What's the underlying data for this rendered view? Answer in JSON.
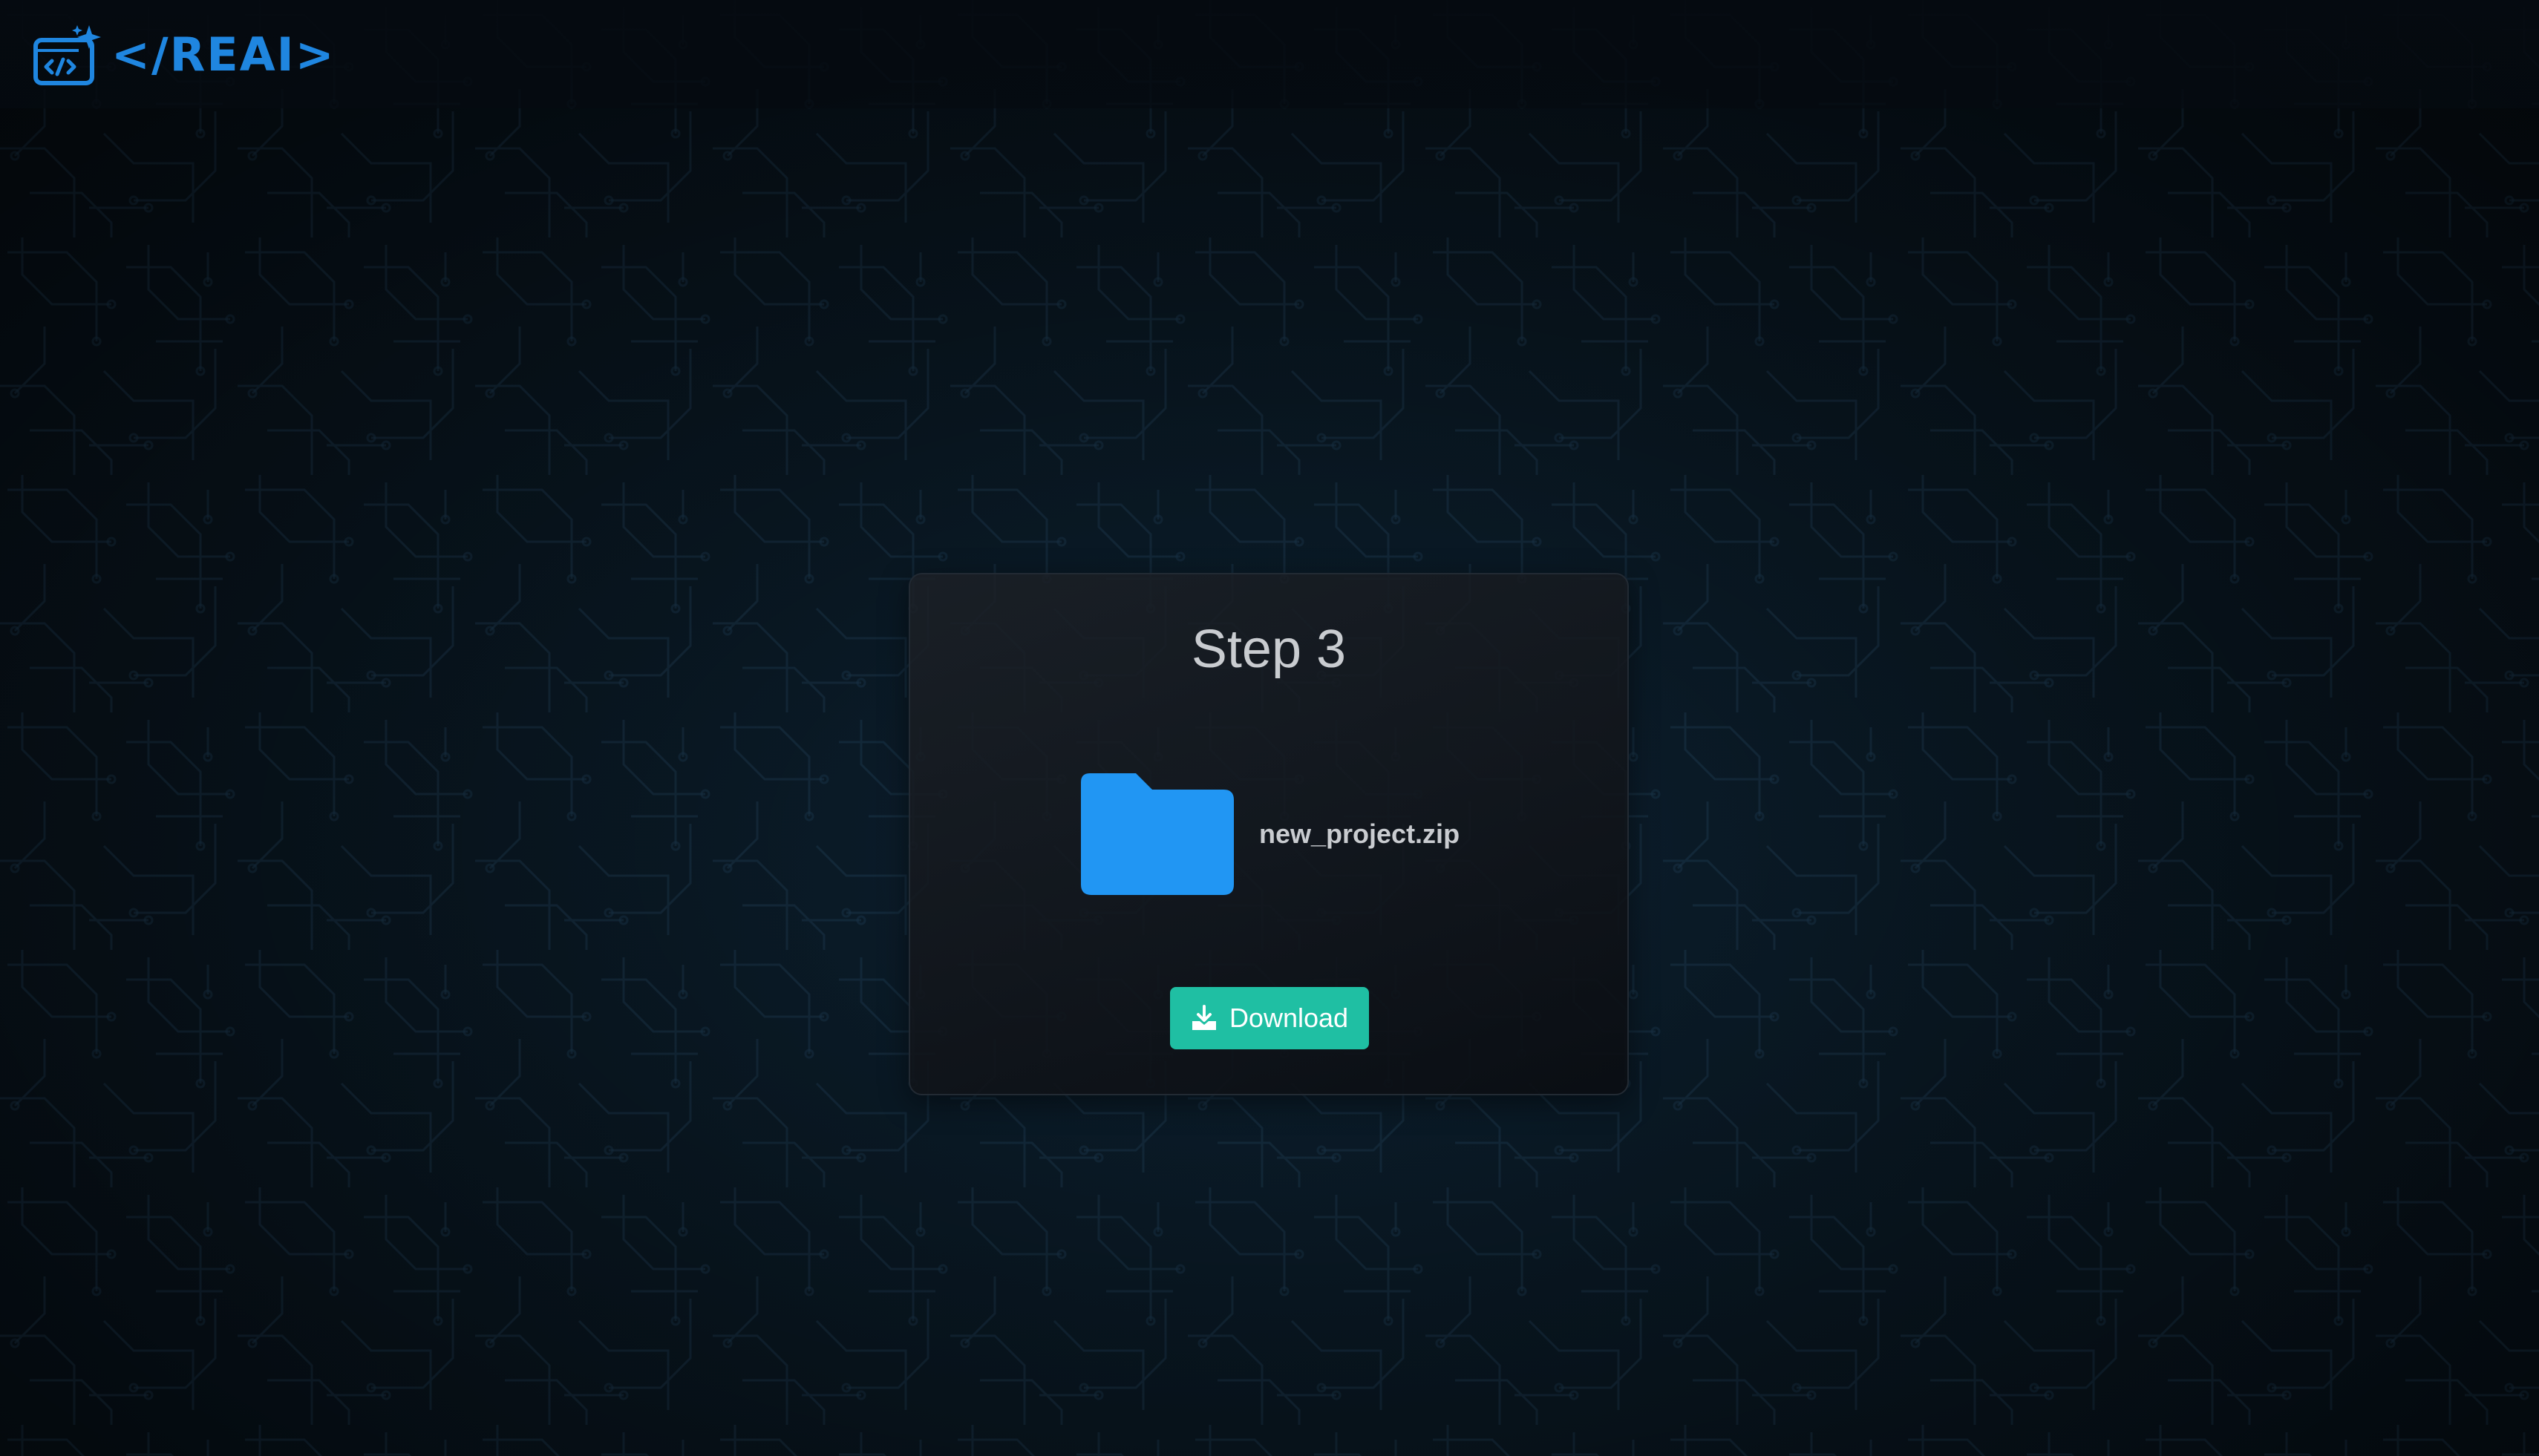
{
  "header": {
    "logo_text": "</REAI>",
    "logo_icon": "code-window-sparkle-icon",
    "brand_color": "#1f86e0"
  },
  "card": {
    "title": "Step 3",
    "file": {
      "name": "new_project.zip",
      "icon": "folder-icon",
      "icon_color": "#2196f3"
    },
    "download_button": {
      "label": "Download",
      "icon": "download-icon",
      "color": "#1fbfa3"
    }
  }
}
